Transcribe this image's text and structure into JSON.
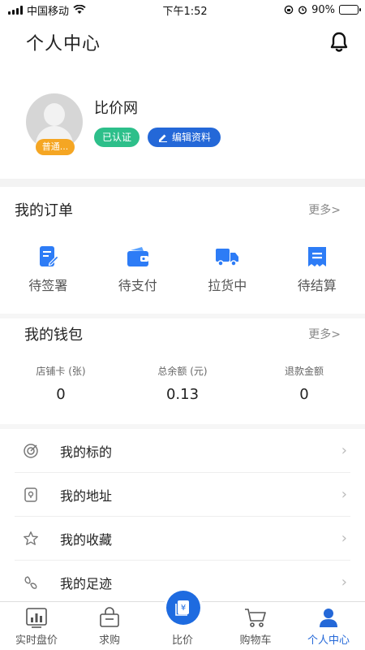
{
  "status_bar": {
    "carrier": "中国移动",
    "time": "下午1:52",
    "battery": "90%"
  },
  "header": {
    "title": "个人中心"
  },
  "profile": {
    "name": "比价网",
    "level": "普通...",
    "verified_label": "已认证",
    "edit_label": "编辑资料"
  },
  "orders": {
    "title": "我的订单",
    "more": "更多>",
    "items": [
      {
        "label": "待签署",
        "icon": "sign-doc-icon"
      },
      {
        "label": "待支付",
        "icon": "wallet-icon"
      },
      {
        "label": "拉货中",
        "icon": "truck-icon"
      },
      {
        "label": "待结算",
        "icon": "settlement-icon"
      }
    ]
  },
  "wallet": {
    "title": "我的钱包",
    "more": "更多>",
    "items": [
      {
        "label": "店铺卡 (张)",
        "value": "0"
      },
      {
        "label": "总余额 (元)",
        "value": "0.13"
      },
      {
        "label": "退款金额",
        "value": "0"
      }
    ]
  },
  "menu": [
    {
      "label": "我的标的",
      "icon": "target-icon"
    },
    {
      "label": "我的地址",
      "icon": "address-icon"
    },
    {
      "label": "我的收藏",
      "icon": "star-icon"
    },
    {
      "label": "我的足迹",
      "icon": "footprint-icon"
    }
  ],
  "tabs": [
    {
      "label": "实时盘价",
      "icon": "chart-icon"
    },
    {
      "label": "求购",
      "icon": "basket-icon"
    },
    {
      "label": "比价",
      "icon": "compare-price-icon"
    },
    {
      "label": "购物车",
      "icon": "cart-icon"
    },
    {
      "label": "个人中心",
      "icon": "user-icon"
    }
  ],
  "colors": {
    "accent": "#2468d8",
    "verified": "#2dbf8a",
    "level": "#f5a623"
  }
}
